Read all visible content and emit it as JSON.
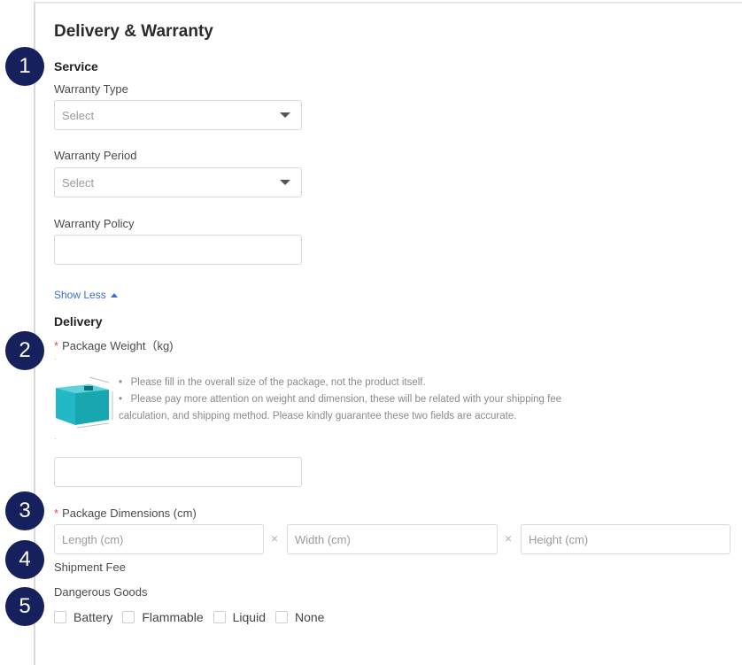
{
  "section": {
    "title": "Delivery & Warranty"
  },
  "service": {
    "heading": "Service",
    "warranty_type": {
      "label": "Warranty Type",
      "value": "Select"
    },
    "warranty_period": {
      "label": "Warranty Period",
      "value": "Select"
    },
    "warranty_policy": {
      "label": "Warranty Policy",
      "value": ""
    },
    "toggle_label": "Show Less"
  },
  "delivery": {
    "heading": "Delivery",
    "package_weight": {
      "required_mark": "*",
      "label": "Package Weight（kg)",
      "tips": [
        "Please fill in the overall size of the package, not the product itself.",
        "Please pay more attention on weight and dimension, these will be related with your shipping fee",
        "calculation, and shipping method. Please kindly guarantee these two fields are accurate."
      ],
      "value": ""
    },
    "package_dimensions": {
      "required_mark": "*",
      "label": "Package Dimensions (cm)",
      "length_placeholder": "Length (cm)",
      "width_placeholder": "Width (cm)",
      "height_placeholder": "Height (cm)",
      "separator": "×"
    },
    "shipment_fee": {
      "label": "Shipment Fee"
    },
    "dangerous_goods": {
      "label": "Dangerous Goods",
      "options": [
        "Battery",
        "Flammable",
        "Liquid",
        "None"
      ]
    }
  },
  "badges": [
    "1",
    "2",
    "3",
    "4",
    "5"
  ],
  "colors": {
    "badge": "#15205c",
    "link": "#3a6fd8",
    "required": "#e14b4b",
    "box_illustration": "#22b8c4"
  },
  "icons": {
    "select_caret": "caret-down-icon",
    "toggle": "caret-up-icon",
    "package": "package-box-icon"
  }
}
